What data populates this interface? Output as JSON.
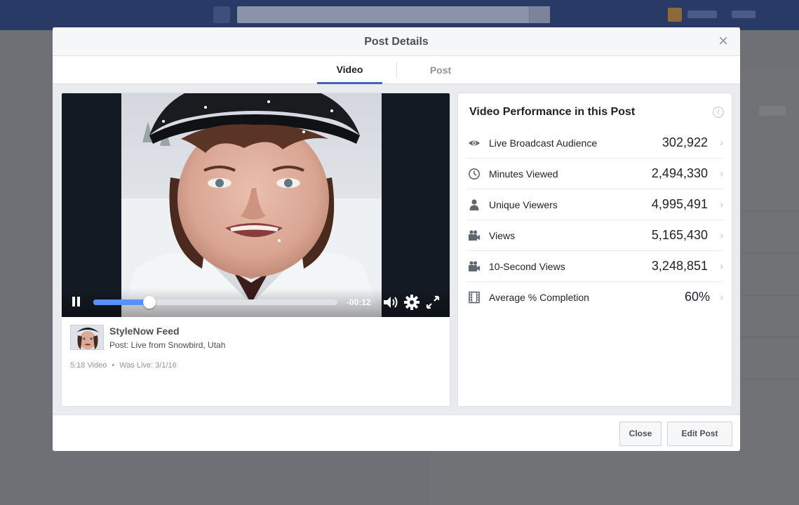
{
  "modal": {
    "title": "Post Details",
    "close_glyph": "×"
  },
  "tabs": [
    {
      "label": "Video",
      "active": true
    },
    {
      "label": "Post",
      "active": false
    }
  ],
  "video": {
    "playback_progress": 0.23,
    "time_remaining": "-00:12",
    "controls": [
      "pause-icon",
      "volume-icon",
      "settings-gear-icon",
      "fullscreen-icon"
    ]
  },
  "post": {
    "page_name": "StyleNow Feed",
    "post_title": "Post: Live from Snowbird, Utah",
    "duration": "5:18 Video",
    "separator": "•",
    "was_live": "Was Live: 3/1/16"
  },
  "performance": {
    "title": "Video Performance in this Post",
    "info_glyph": "i",
    "metrics": [
      {
        "icon": "eye-icon",
        "label": "Live Broadcast Audience",
        "value": "302,922"
      },
      {
        "icon": "clock-icon",
        "label": "Minutes Viewed",
        "value": "2,494,330"
      },
      {
        "icon": "person-icon",
        "label": "Unique Viewers",
        "value": "4,995,491"
      },
      {
        "icon": "video-camera-icon",
        "label": "Views",
        "value": "5,165,430"
      },
      {
        "icon": "video-camera-icon",
        "label": "10-Second Views",
        "value": "3,248,851"
      },
      {
        "icon": "film-icon",
        "label": "Average % Completion",
        "value": "60%"
      }
    ],
    "chevron": "›"
  },
  "footer": {
    "close_label": "Close",
    "edit_label": "Edit Post"
  },
  "colors": {
    "accent": "#4267b2",
    "progress": "#5890ff",
    "overlay": "#6e7075"
  }
}
